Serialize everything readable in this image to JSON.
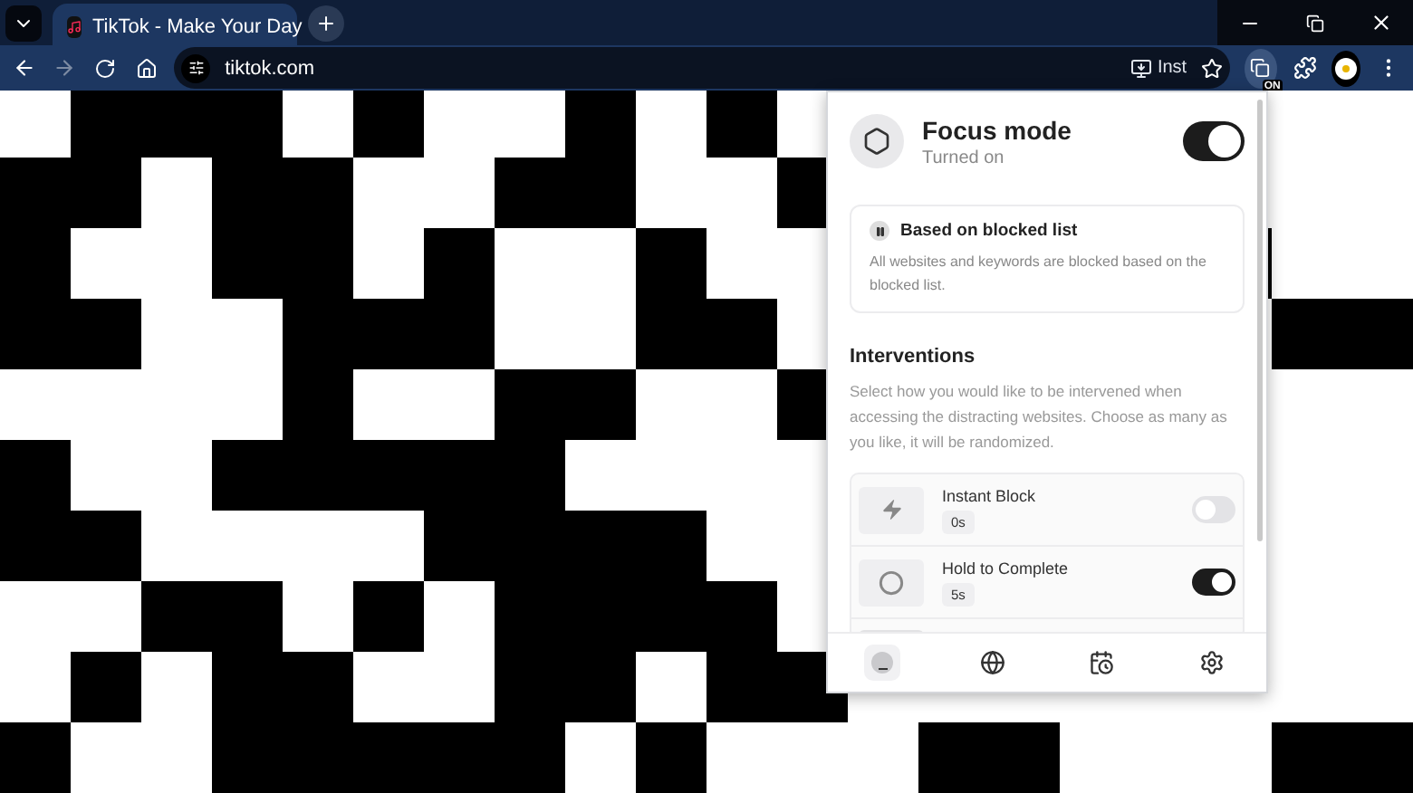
{
  "browser": {
    "tab": {
      "title": "TikTok - Make Your Day",
      "selected": true
    },
    "url": "tiktok.com",
    "install_label": "Inst",
    "extension_badge": "ON"
  },
  "panel": {
    "title": "Focus mode",
    "status": "Turned on",
    "on": true,
    "mode_card": {
      "title": "Based on blocked list",
      "description": "All websites and keywords are blocked based on the blocked list."
    },
    "interventions": {
      "heading": "Interventions",
      "description": "Select how you would like to be intervened when accessing the distracting websites. Choose as many as you like, it will be randomized.",
      "items": [
        {
          "kind": "bolt",
          "name": "Instant Block",
          "duration": "0s",
          "on": false
        },
        {
          "kind": "circle",
          "name": "Hold to Complete",
          "duration": "5s",
          "on": true
        },
        {
          "kind": "stub"
        }
      ]
    },
    "nav": [
      {
        "kind": "focus",
        "selected": true
      },
      {
        "kind": "globe",
        "selected": false
      },
      {
        "kind": "calendar",
        "selected": false
      },
      {
        "kind": "settings",
        "selected": false
      }
    ]
  }
}
